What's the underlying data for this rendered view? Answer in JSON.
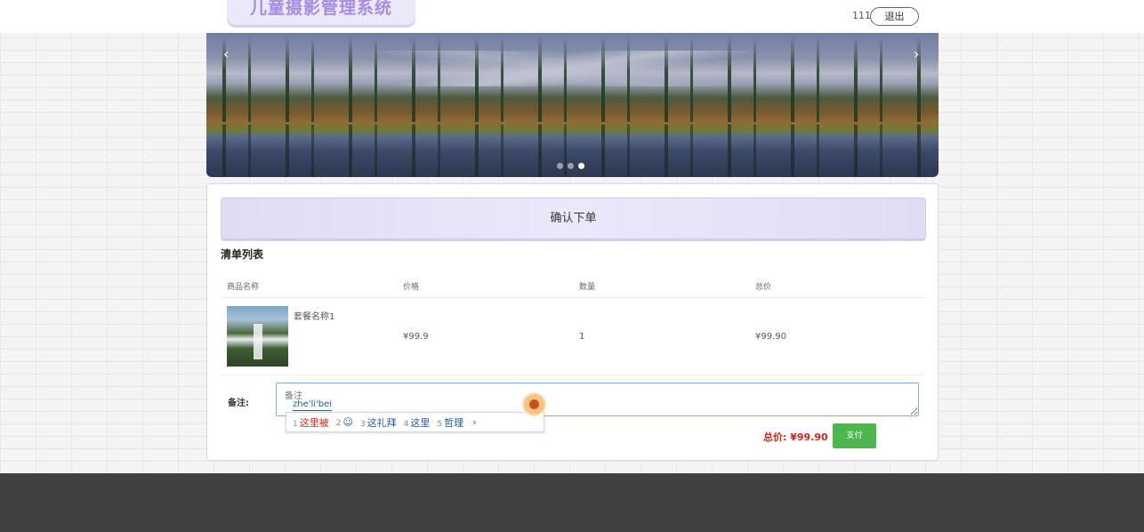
{
  "header": {
    "logo_text": "儿童摄影管理系统",
    "user_name": "111",
    "logout_label": "退出"
  },
  "banner": {
    "prev_arrow": "‹",
    "next_arrow": "›",
    "slide_count": 3,
    "active_slide": 3
  },
  "order": {
    "title": "确认下单",
    "list_title": "清单列表",
    "columns": [
      "商品名称",
      "价格",
      "数量",
      "总价"
    ],
    "items": [
      {
        "name": "套餐名称1",
        "price": "¥99.9",
        "quantity": "1",
        "total": "¥99.90"
      }
    ],
    "remark_label": "备注:",
    "remark_placeholder": "备注",
    "total_label": "总价: ¥99.90",
    "pay_label": "支付"
  },
  "ime": {
    "composition": "zhe'li'bei",
    "candidates": [
      {
        "num": "1",
        "text": "这里被"
      },
      {
        "num": "2",
        "text": "☺"
      },
      {
        "num": "3",
        "text": "这礼拜"
      },
      {
        "num": "4",
        "text": "这里"
      },
      {
        "num": "5",
        "text": "哲理"
      }
    ],
    "next_label": "›"
  },
  "colors": {
    "accent_purple": "#ebe8fa",
    "price_red": "#d0261c",
    "pay_green": "#4cb74c",
    "footer": "#414141"
  }
}
